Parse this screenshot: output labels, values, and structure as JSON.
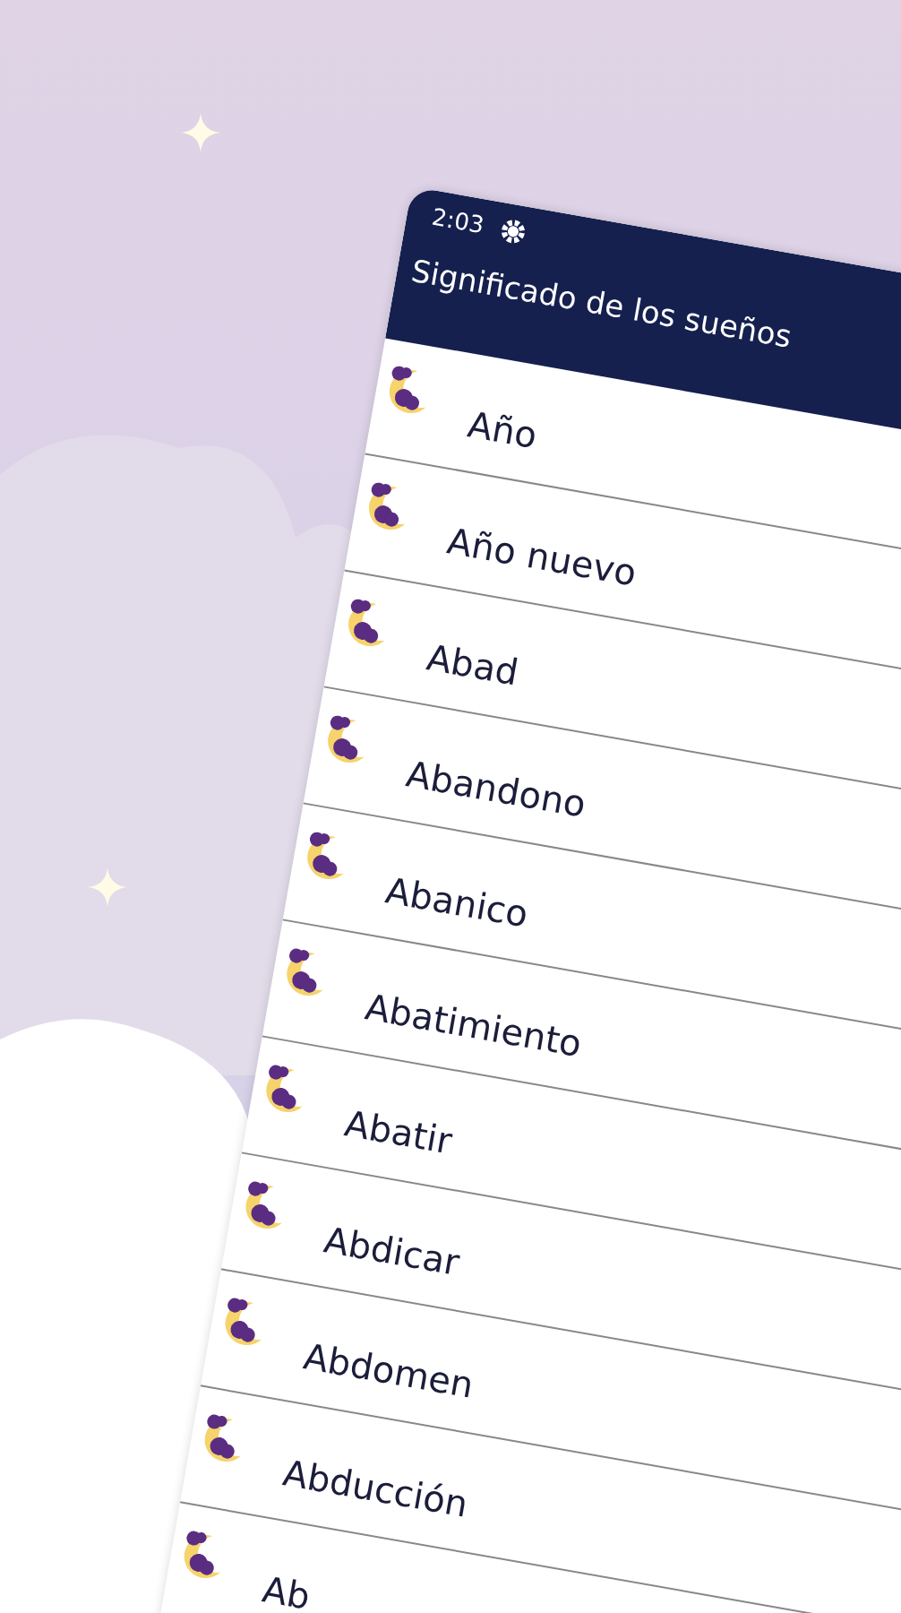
{
  "status_bar": {
    "time": "2:03"
  },
  "app_bar": {
    "title": "Significado de los sueños"
  },
  "items": [
    {
      "label": "Año"
    },
    {
      "label": "Año nuevo"
    },
    {
      "label": "Abad"
    },
    {
      "label": "Abandono"
    },
    {
      "label": "Abanico"
    },
    {
      "label": "Abatimiento"
    },
    {
      "label": "Abatir"
    },
    {
      "label": "Abdicar"
    },
    {
      "label": "Abdomen"
    },
    {
      "label": "Abducción"
    },
    {
      "label": "Ab"
    }
  ]
}
